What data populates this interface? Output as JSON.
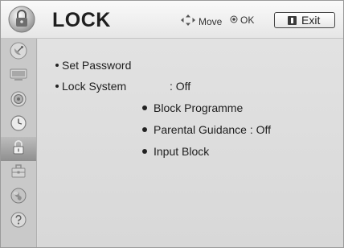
{
  "header": {
    "title": "LOCK",
    "move_label": "Move",
    "ok_label": "OK",
    "exit_label": "Exit"
  },
  "sidebar": {
    "items": [
      {
        "icon": "satellite-dish-icon",
        "active": false
      },
      {
        "icon": "tv-screen-icon",
        "active": false
      },
      {
        "icon": "speaker-icon",
        "active": false
      },
      {
        "icon": "clock-icon",
        "active": false
      },
      {
        "icon": "padlock-icon",
        "active": true
      },
      {
        "icon": "toolbox-icon",
        "active": false
      },
      {
        "icon": "globe-icon",
        "active": false
      },
      {
        "icon": "help-icon",
        "active": false
      }
    ]
  },
  "menu": {
    "set_password": "Set Password",
    "lock_system": "Lock System",
    "lock_system_value": ": Off",
    "block_programme": "Block Programme",
    "parental_guidance": "Parental Guidance : Off",
    "input_block": "Input Block"
  },
  "colors": {
    "background": "#dcdcdc",
    "sidebar": "#c9c9c9",
    "active_tab": "#9a9a9a",
    "text": "#1e1e1e"
  }
}
